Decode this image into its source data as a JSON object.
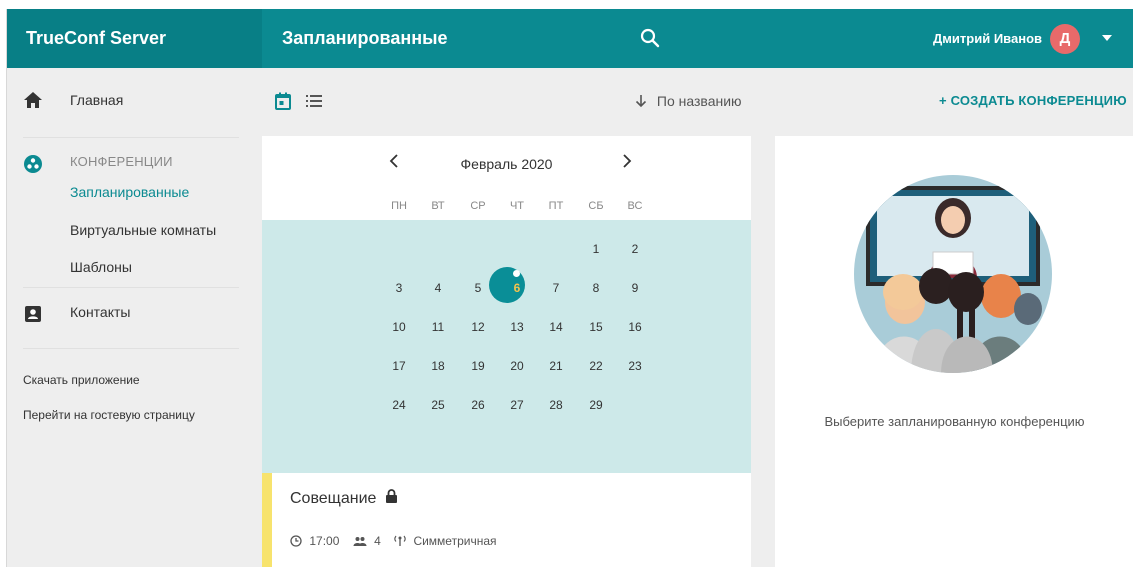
{
  "app": {
    "title": "TrueConf Server"
  },
  "header": {
    "page_title": "Запланированные",
    "user_name": "Дмитрий Иванов",
    "avatar_letter": "Д"
  },
  "sidebar": {
    "home": "Главная",
    "conferences_section": "КОНФЕРЕНЦИИ",
    "scheduled": "Запланированные",
    "virtual_rooms": "Виртуальные комнаты",
    "templates": "Шаблоны",
    "contacts": "Контакты",
    "download_app": "Скачать приложение",
    "guest_page": "Перейти на гостевую страницу"
  },
  "toolbar": {
    "sort_label": "По названию",
    "create_label": "+ СОЗДАТЬ КОНФЕРЕНЦИЮ"
  },
  "calendar": {
    "month": "Февраль 2020",
    "weekdays": [
      "ПН",
      "ВТ",
      "СР",
      "ЧТ",
      "ПТ",
      "СБ",
      "ВС"
    ],
    "weeks": [
      [
        "",
        "",
        "",
        "",
        "",
        "1",
        "2"
      ],
      [
        "3",
        "4",
        "5",
        "6",
        "7",
        "8",
        "9"
      ],
      [
        "10",
        "11",
        "12",
        "13",
        "14",
        "15",
        "16"
      ],
      [
        "17",
        "18",
        "19",
        "20",
        "21",
        "22",
        "23"
      ],
      [
        "24",
        "25",
        "26",
        "27",
        "28",
        "29",
        ""
      ]
    ],
    "today": "6"
  },
  "meeting": {
    "title": "Совещание",
    "time": "17:00",
    "participants": "4",
    "mode": "Симметричная"
  },
  "detail": {
    "placeholder": "Выберите запланированную конференцию"
  },
  "colors": {
    "header": "#0b8a91",
    "accent": "#0b8a91",
    "calendar_range": "#cde9e9",
    "meeting_stripe": "#f7e36d",
    "avatar": "#e86a6a"
  },
  "icons": [
    "search-icon",
    "home-icon",
    "conference-icon",
    "contacts-icon",
    "calendar-view-icon",
    "list-view-icon",
    "sort-arrow-icon",
    "lock-icon",
    "clock-icon",
    "participants-icon",
    "mode-icon"
  ]
}
